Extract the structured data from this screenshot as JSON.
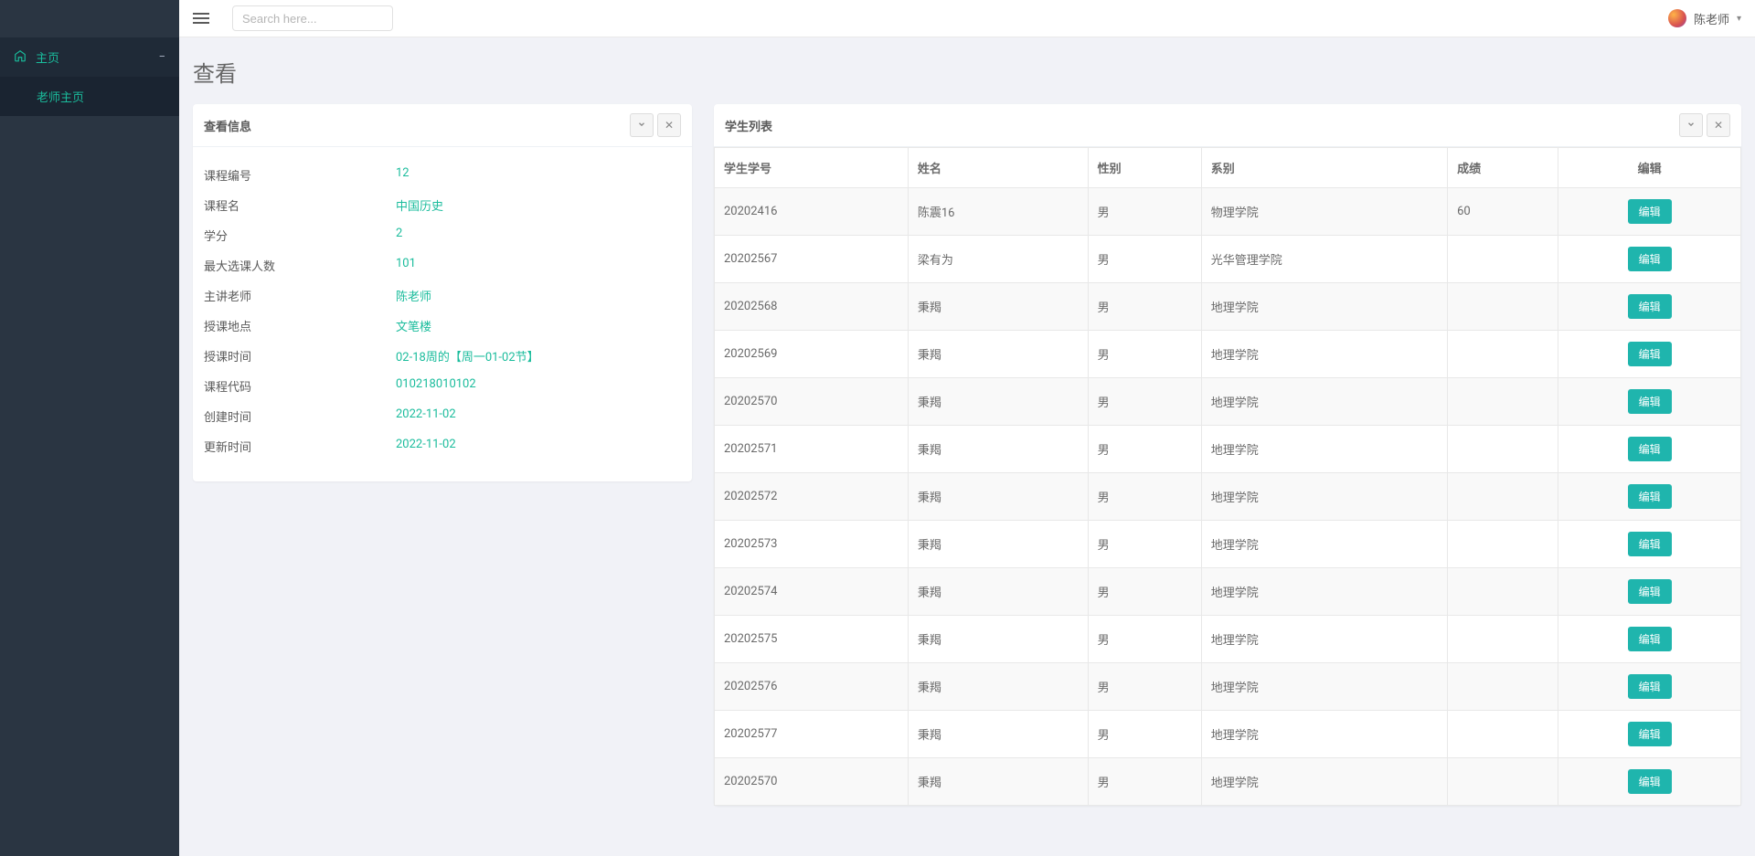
{
  "sidebar": {
    "main_label": "主页",
    "sub_label": "老师主页"
  },
  "topbar": {
    "search_placeholder": "Search here...",
    "username": "陈老师"
  },
  "page": {
    "title": "查看"
  },
  "info_panel": {
    "title": "查看信息",
    "rows": [
      {
        "label": "课程编号",
        "value": "12"
      },
      {
        "label": "课程名",
        "value": "中国历史"
      },
      {
        "label": "学分",
        "value": "2"
      },
      {
        "label": "最大选课人数",
        "value": "101"
      },
      {
        "label": "主讲老师",
        "value": "陈老师"
      },
      {
        "label": "授课地点",
        "value": "文笔楼"
      },
      {
        "label": "授课时间",
        "value": "02-18周的【周一01-02节】"
      },
      {
        "label": "课程代码",
        "value": "010218010102"
      },
      {
        "label": "创建时间",
        "value": "2022-11-02"
      },
      {
        "label": "更新时间",
        "value": "2022-11-02"
      }
    ]
  },
  "table_panel": {
    "title": "学生列表",
    "headers": {
      "id": "学生学号",
      "name": "姓名",
      "gender": "性别",
      "dept": "系别",
      "score": "成绩",
      "edit": "编辑"
    },
    "edit_label": "编辑",
    "rows": [
      {
        "id": "20202416",
        "name": "陈震16",
        "gender": "男",
        "dept": "物理学院",
        "score": "60"
      },
      {
        "id": "20202567",
        "name": "梁有为",
        "gender": "男",
        "dept": "光华管理学院",
        "score": ""
      },
      {
        "id": "20202568",
        "name": "秉羯",
        "gender": "男",
        "dept": "地理学院",
        "score": ""
      },
      {
        "id": "20202569",
        "name": "秉羯",
        "gender": "男",
        "dept": "地理学院",
        "score": ""
      },
      {
        "id": "20202570",
        "name": "秉羯",
        "gender": "男",
        "dept": "地理学院",
        "score": ""
      },
      {
        "id": "20202571",
        "name": "秉羯",
        "gender": "男",
        "dept": "地理学院",
        "score": ""
      },
      {
        "id": "20202572",
        "name": "秉羯",
        "gender": "男",
        "dept": "地理学院",
        "score": ""
      },
      {
        "id": "20202573",
        "name": "秉羯",
        "gender": "男",
        "dept": "地理学院",
        "score": ""
      },
      {
        "id": "20202574",
        "name": "秉羯",
        "gender": "男",
        "dept": "地理学院",
        "score": ""
      },
      {
        "id": "20202575",
        "name": "秉羯",
        "gender": "男",
        "dept": "地理学院",
        "score": ""
      },
      {
        "id": "20202576",
        "name": "秉羯",
        "gender": "男",
        "dept": "地理学院",
        "score": ""
      },
      {
        "id": "20202577",
        "name": "秉羯",
        "gender": "男",
        "dept": "地理学院",
        "score": ""
      },
      {
        "id": "20202570",
        "name": "秉羯",
        "gender": "男",
        "dept": "地理学院",
        "score": ""
      }
    ]
  }
}
